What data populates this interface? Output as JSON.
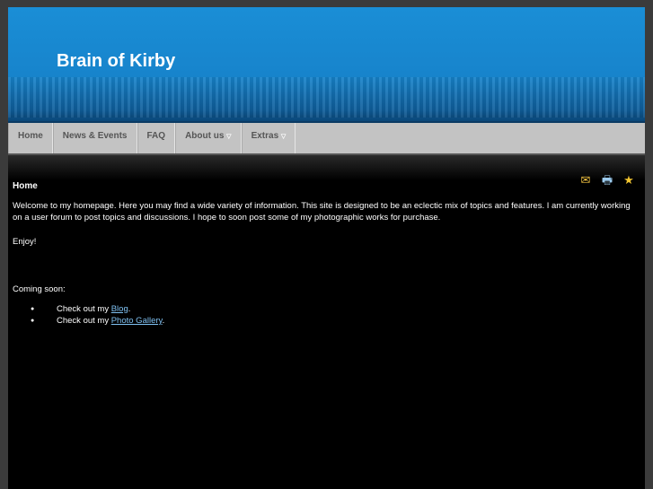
{
  "site": {
    "title": "Brain of Kirby"
  },
  "nav": [
    {
      "label": "Home"
    },
    {
      "label": "News & Events"
    },
    {
      "label": "FAQ"
    },
    {
      "label": "About us",
      "dropdown": true
    },
    {
      "label": "Extras",
      "dropdown": true
    }
  ],
  "page": {
    "title": "Home",
    "intro": "Welcome to my homepage.  Here you may find a wide variety of information.  This site is designed to be an eclectic mix of topics and features.  I am currently working on a user forum to post topics and discussions.  I hope to soon post some of my photographic works for purchase.",
    "enjoy": "Enjoy!",
    "coming": "Coming soon:",
    "items": [
      {
        "prefix": "Check out my ",
        "link": "Blog",
        "suffix": "."
      },
      {
        "prefix": "Check out my ",
        "link": "Photo Gallery",
        "suffix": "."
      }
    ],
    "icons": [
      "email-icon",
      "print-icon",
      "favorites-icon"
    ]
  }
}
